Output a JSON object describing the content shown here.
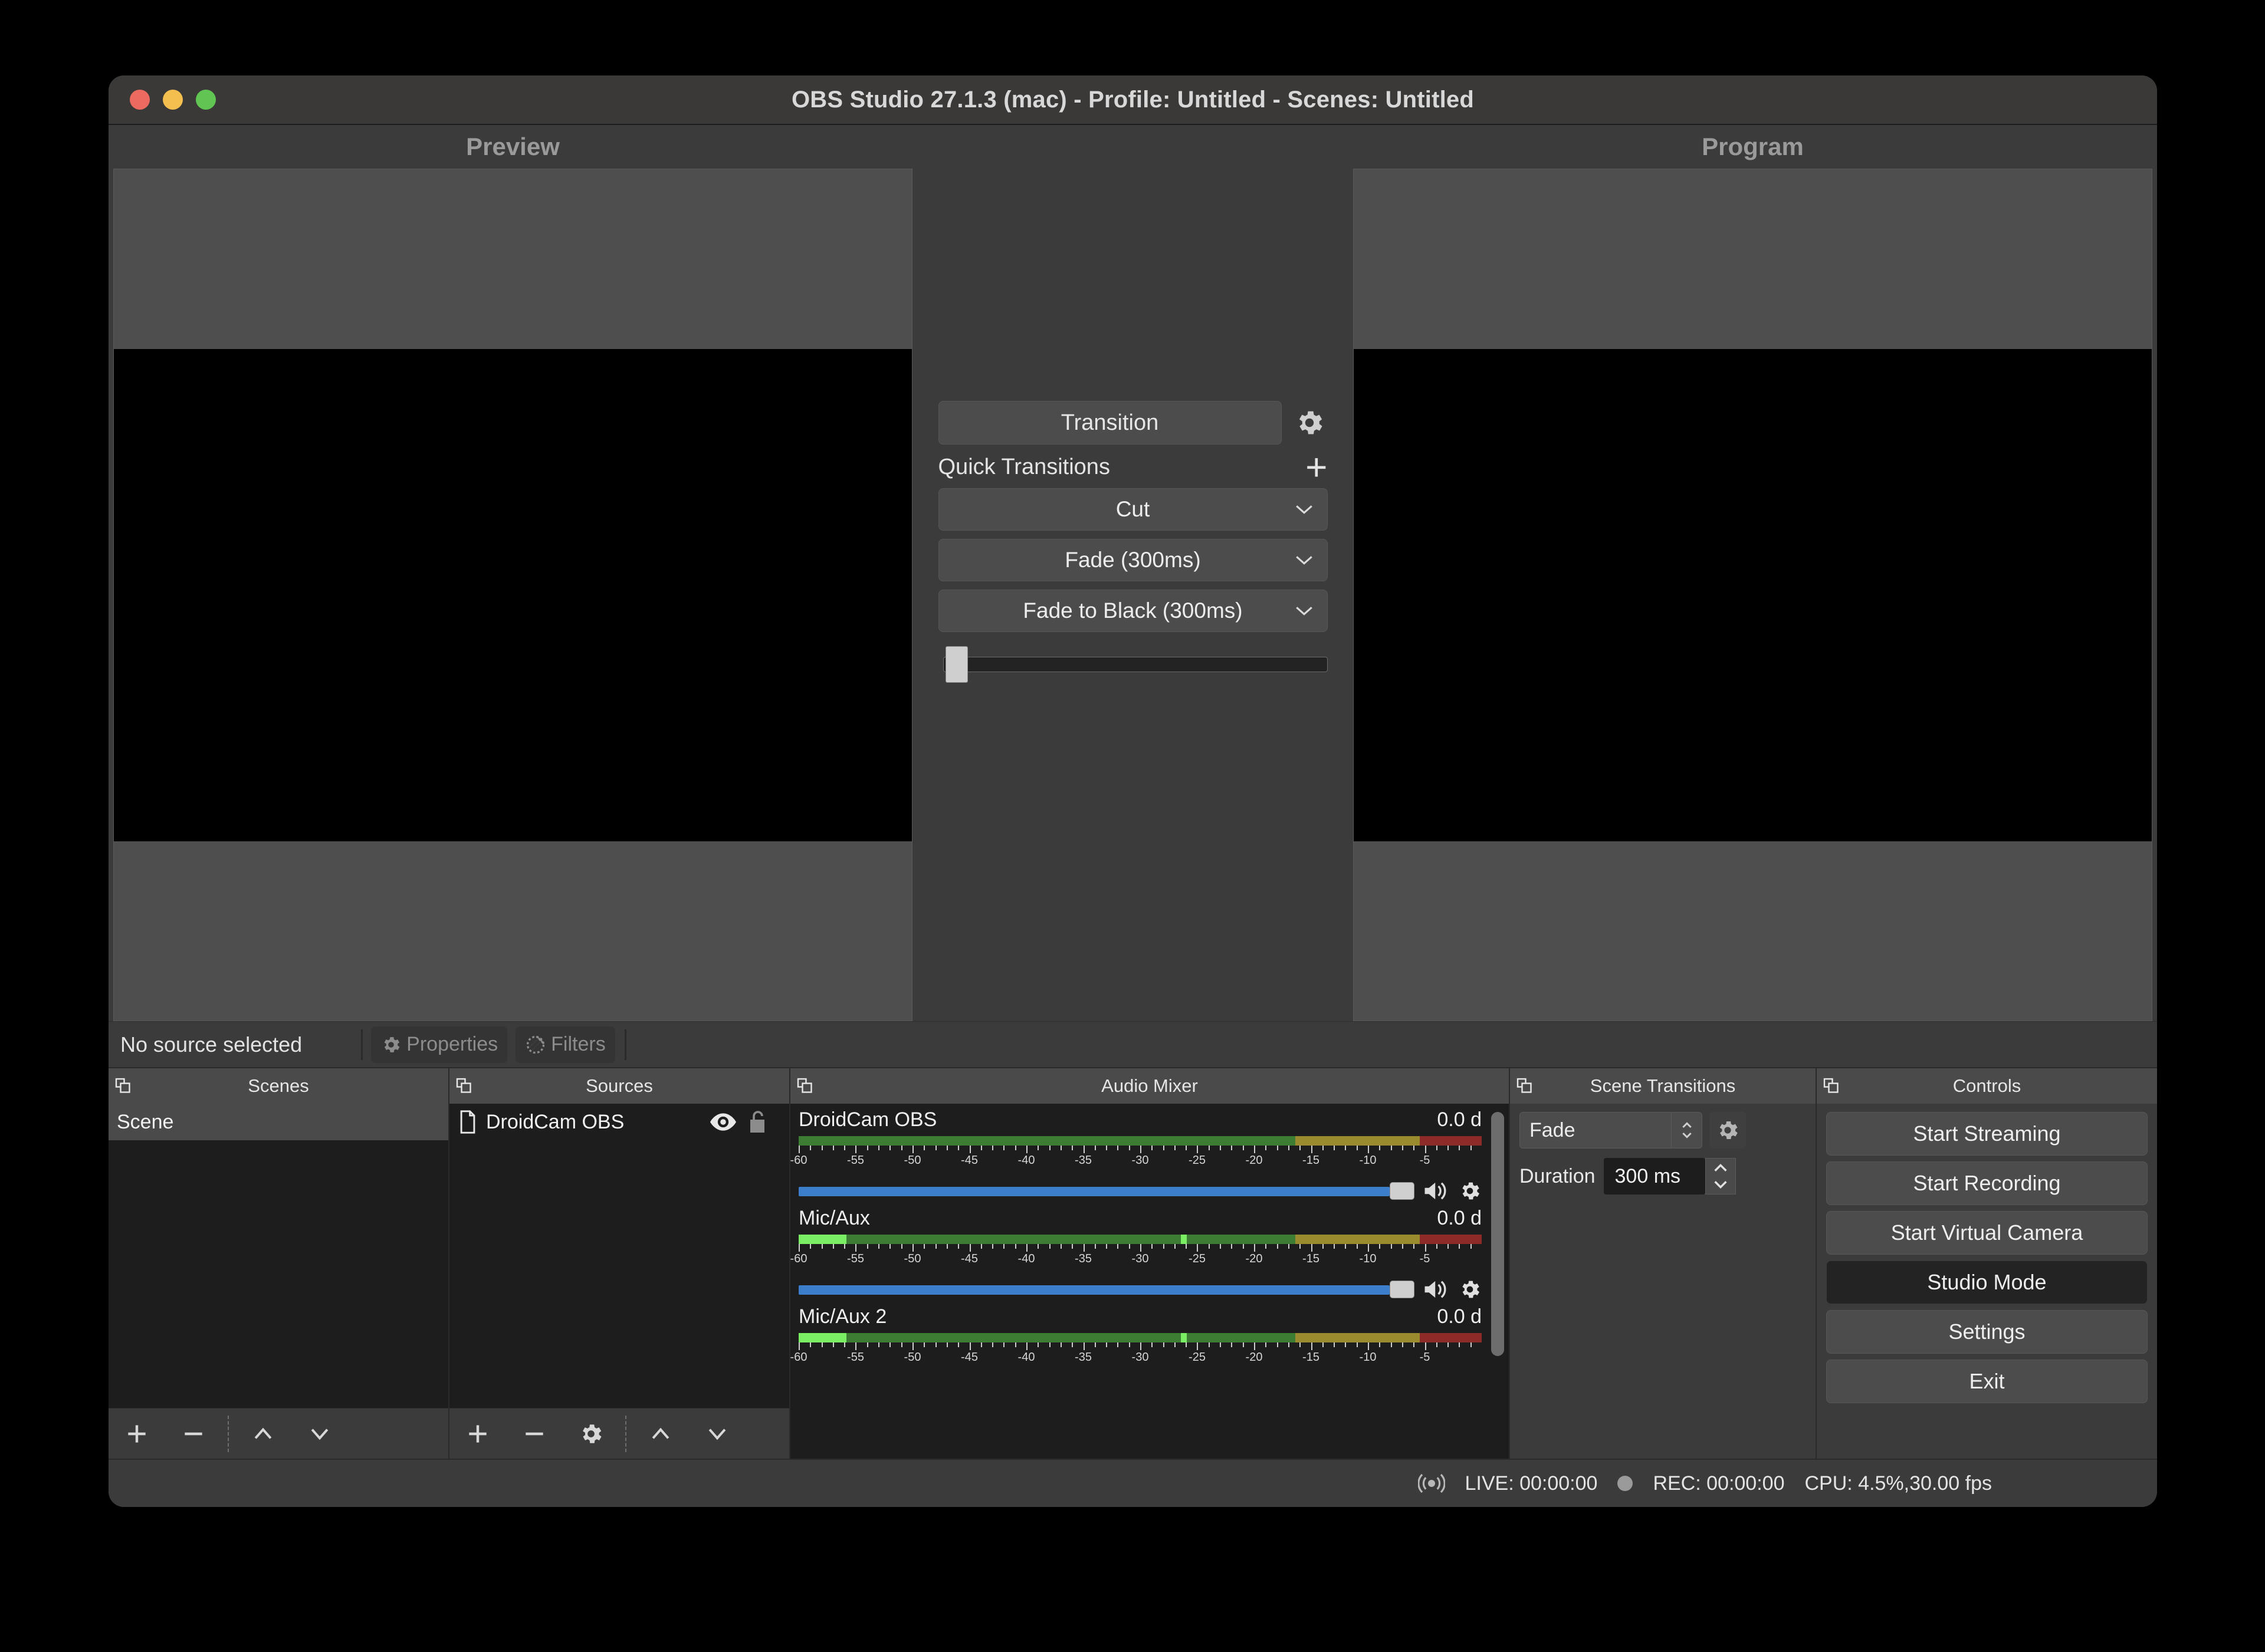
{
  "window": {
    "title": "OBS Studio 27.1.3 (mac) - Profile: Untitled - Scenes: Untitled",
    "traffic_lights": [
      "close",
      "minimize",
      "zoom"
    ]
  },
  "stage": {
    "preview_label": "Preview",
    "program_label": "Program"
  },
  "transitions_center": {
    "transition_button": "Transition",
    "transition_gear_icon": "gear-icon",
    "quick_transitions_label": "Quick Transitions",
    "add_icon": "plus-icon",
    "quick_items": [
      {
        "label": "Cut"
      },
      {
        "label": "Fade (300ms)"
      },
      {
        "label": "Fade to Black (300ms)"
      }
    ],
    "tbar_value": 0
  },
  "source_strip": {
    "status_text": "No source selected",
    "properties_label": "Properties",
    "properties_icon": "gear-icon",
    "filters_label": "Filters",
    "filters_icon": "filters-icon",
    "enabled": false
  },
  "scenes_dock": {
    "title": "Scenes",
    "float_icon": "dock-float-icon",
    "items": [
      {
        "name": "Scene",
        "selected": true
      }
    ],
    "toolbar": [
      {
        "name": "add-scene",
        "icon": "plus-icon"
      },
      {
        "name": "remove-scene",
        "icon": "minus-icon"
      },
      {
        "name": "move-scene-up",
        "icon": "chevron-up-icon"
      },
      {
        "name": "move-scene-down",
        "icon": "chevron-down-icon"
      }
    ]
  },
  "sources_dock": {
    "title": "Sources",
    "float_icon": "dock-float-icon",
    "items": [
      {
        "name": "DroidCam OBS",
        "type_icon": "document-icon",
        "visible": true,
        "visibility_icon": "eye-icon",
        "locked": false,
        "lock_icon": "unlock-icon"
      }
    ],
    "toolbar": [
      {
        "name": "add-source",
        "icon": "plus-icon"
      },
      {
        "name": "remove-source",
        "icon": "minus-icon"
      },
      {
        "name": "source-properties",
        "icon": "gear-icon"
      },
      {
        "name": "move-source-up",
        "icon": "chevron-up-icon"
      },
      {
        "name": "move-source-down",
        "icon": "chevron-down-icon"
      }
    ]
  },
  "audio_mixer": {
    "title": "Audio Mixer",
    "float_icon": "dock-float-icon",
    "scale_labels": [
      "-60",
      "-55",
      "-50",
      "-45",
      "-40",
      "-35",
      "-30",
      "-25",
      "-20",
      "-15",
      "-10",
      "-5"
    ],
    "channels": [
      {
        "name": "DroidCam OBS",
        "db": "0.0 d",
        "volume_percent": 100,
        "level_percent": 0,
        "peak_percent": 0,
        "mute_icon": "speaker-on-icon",
        "config_icon": "gear-icon"
      },
      {
        "name": "Mic/Aux",
        "db": "0.0 d",
        "volume_percent": 100,
        "level_percent": 7,
        "peak_percent": 56,
        "mute_icon": "speaker-on-icon",
        "config_icon": "gear-icon"
      },
      {
        "name": "Mic/Aux 2",
        "db": "0.0 d",
        "volume_percent": 100,
        "level_percent": 7,
        "peak_percent": 56,
        "mute_icon": "speaker-on-icon",
        "config_icon": "gear-icon"
      }
    ]
  },
  "scene_transitions": {
    "title": "Scene Transitions",
    "float_icon": "dock-float-icon",
    "selected_transition": "Fade",
    "gear_icon": "gear-icon",
    "duration_label": "Duration",
    "duration_value": "300 ms"
  },
  "controls": {
    "title": "Controls",
    "float_icon": "dock-float-icon",
    "buttons": [
      {
        "label": "Start Streaming",
        "active": false
      },
      {
        "label": "Start Recording",
        "active": false
      },
      {
        "label": "Start Virtual Camera",
        "active": false
      },
      {
        "label": "Studio Mode",
        "active": true
      },
      {
        "label": "Settings",
        "active": false
      },
      {
        "label": "Exit",
        "active": false
      }
    ]
  },
  "statusbar": {
    "live_icon": "broadcast-icon",
    "live": "LIVE: 00:00:00",
    "rec_icon": "record-dot-icon",
    "rec": "REC: 00:00:00",
    "cpu": "CPU: 4.5%,30.00 fps"
  },
  "colors": {
    "window_bg": "#3b3b3b",
    "dock_bg": "#1d1d1d",
    "accent_blue": "#3c7ec9",
    "meter_green": "#3d7c33",
    "meter_yellow": "#9a8c2e",
    "meter_red": "#8c2b27",
    "meter_peak": "#7bef63"
  }
}
